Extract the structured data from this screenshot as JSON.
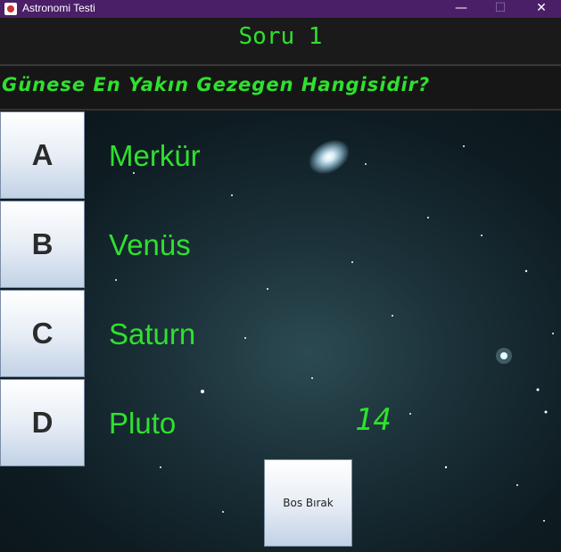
{
  "window": {
    "title": "Astronomi  Testi",
    "minimize": "—",
    "maximize": "☐",
    "close": "✕"
  },
  "header": {
    "question_number": "Soru 1"
  },
  "question": {
    "text": "Günese En Yakın Gezegen Hangisidir?"
  },
  "options": [
    {
      "letter": "A",
      "text": "Merkür"
    },
    {
      "letter": "B",
      "text": "Venüs"
    },
    {
      "letter": "C",
      "text": "Saturn"
    },
    {
      "letter": "D",
      "text": "Pluto"
    }
  ],
  "timer": "14",
  "skip_button": "Bos Bırak",
  "colors": {
    "accent": "#2fe02f",
    "titlebar": "#4a1f68"
  }
}
